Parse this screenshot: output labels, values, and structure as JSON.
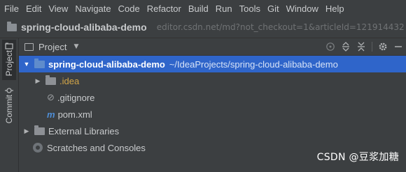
{
  "menubar": {
    "items": [
      "File",
      "Edit",
      "View",
      "Navigate",
      "Code",
      "Refactor",
      "Build",
      "Run",
      "Tools",
      "Git",
      "Window",
      "Help"
    ]
  },
  "titlebar": {
    "project_name": "spring-cloud-alibaba-demo",
    "background_url": "editor.csdn.net/md?not_checkout=1&articleId=121914432"
  },
  "left_toolwindows": {
    "project_label": "Project",
    "commit_label": "Commit"
  },
  "project_panel": {
    "title": "Project",
    "tools": [
      "target-icon",
      "expand-all-icon",
      "collapse-all-icon",
      "gear-icon",
      "minimize-icon"
    ]
  },
  "tree": {
    "root": {
      "name": "spring-cloud-alibaba-demo",
      "path": "~/IdeaProjects/spring-cloud-alibaba-demo"
    },
    "idea": ".idea",
    "gitignore": ".gitignore",
    "pom": "pom.xml",
    "pom_icon_letter": "m",
    "external_libraries": "External Libraries",
    "scratches": "Scratches and Consoles"
  },
  "watermark": "CSDN @豆浆加糖",
  "colors": {
    "selection": "#2f65ca",
    "background": "#3c3f41",
    "idea_folder_text": "#d2a548",
    "maven_icon": "#4f8ed6"
  }
}
